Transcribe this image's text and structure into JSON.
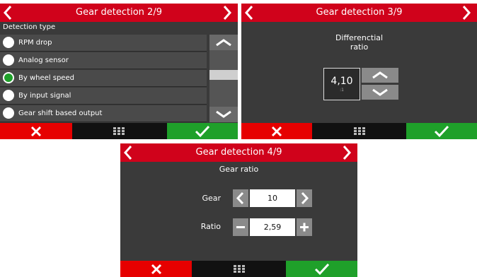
{
  "screen1": {
    "title": "Gear detection 2/9",
    "list_header": "Detection type",
    "options": [
      {
        "label": "RPM drop",
        "selected": false
      },
      {
        "label": "Analog sensor",
        "selected": false
      },
      {
        "label": "By wheel speed",
        "selected": true
      },
      {
        "label": "By input signal",
        "selected": false
      },
      {
        "label": "Gear shift based output",
        "selected": false
      }
    ]
  },
  "screen2": {
    "title": "Gear detection 3/9",
    "field_label": "Differenctial\nratio",
    "value": "4,10",
    "unit": ":1"
  },
  "screen3": {
    "title": "Gear detection 4/9",
    "subtitle": "Gear ratio",
    "gear_label": "Gear",
    "gear_value": "10",
    "ratio_label": "Ratio",
    "ratio_value": "2,59"
  },
  "colors": {
    "titlebar": "#d0021b",
    "cancel": "#e60000",
    "confirm": "#1fa02a",
    "panel": "#3a3a3a"
  },
  "icons": {
    "prev": "chevron-left-icon",
    "next": "chevron-right-icon",
    "cancel": "x-icon",
    "menu": "grid-icon",
    "confirm": "check-icon"
  }
}
